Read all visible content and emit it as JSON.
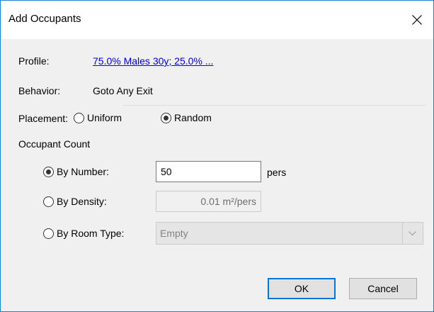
{
  "window": {
    "title": "Add Occupants",
    "close_icon": "close-icon",
    "accent_color": "#0078d7"
  },
  "profile": {
    "label": "Profile:",
    "value": "75.0% Males 30y; 25.0% ..."
  },
  "behavior": {
    "label": "Behavior:",
    "value": "Goto Any Exit"
  },
  "placement": {
    "label": "Placement:",
    "options": [
      {
        "label": "Uniform",
        "checked": false
      },
      {
        "label": "Random",
        "checked": true
      }
    ]
  },
  "occupant_count": {
    "group_label": "Occupant Count",
    "by_number": {
      "label": "By Number:",
      "checked": true,
      "value": "50",
      "unit": "pers"
    },
    "by_density": {
      "label": "By Density:",
      "checked": false,
      "value": "0.01 m²/pers"
    },
    "by_room_type": {
      "label": "By Room Type:",
      "checked": false,
      "selected": "Empty",
      "chevron_icon": "chevron-down-icon"
    }
  },
  "buttons": {
    "ok": "OK",
    "cancel": "Cancel"
  }
}
